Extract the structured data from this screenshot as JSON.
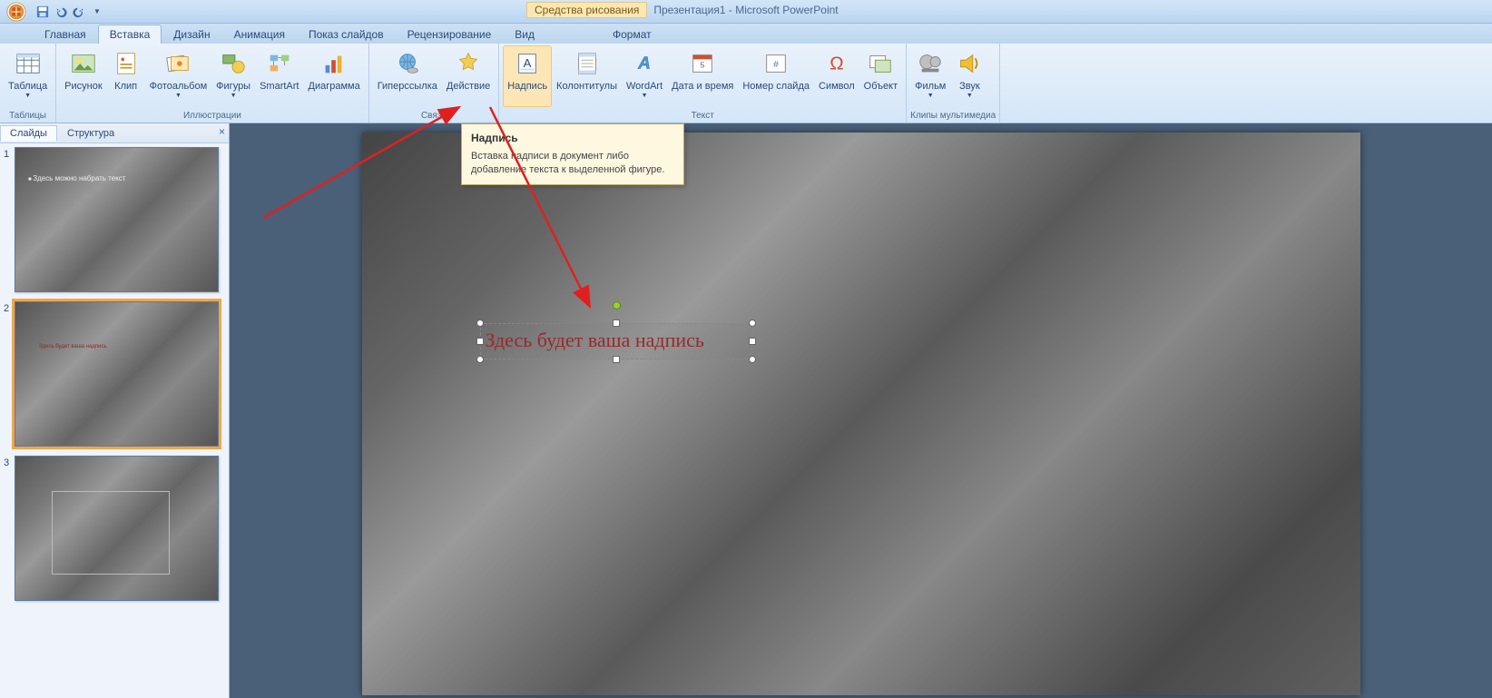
{
  "app": {
    "title_document": "Презентация1",
    "title_app": "Microsoft PowerPoint",
    "contextual_tab_group": "Средства рисования"
  },
  "qat": {
    "save": "save",
    "undo": "undo",
    "redo": "redo"
  },
  "tabs": {
    "home": "Главная",
    "insert": "Вставка",
    "design": "Дизайн",
    "animations": "Анимация",
    "slideshow": "Показ слайдов",
    "review": "Рецензирование",
    "view": "Вид",
    "format": "Формат"
  },
  "ribbon": {
    "groups": {
      "tables": "Таблицы",
      "illustrations": "Иллюстрации",
      "links": "Связи",
      "text": "Текст",
      "media": "Клипы мультимедиа"
    },
    "buttons": {
      "table": "Таблица",
      "picture": "Рисунок",
      "clip": "Клип",
      "photo_album": "Фотоальбом",
      "shapes": "Фигуры",
      "smartart": "SmartArt",
      "chart": "Диаграмма",
      "hyperlink": "Гиперссылка",
      "action": "Действие",
      "textbox": "Надпись",
      "header_footer": "Колонтитулы",
      "wordart": "WordArt",
      "datetime": "Дата и время",
      "slide_number": "Номер слайда",
      "symbol": "Символ",
      "object": "Объект",
      "movie": "Фильм",
      "sound": "Звук"
    }
  },
  "tooltip": {
    "title": "Надпись",
    "body": "Вставка надписи в документ либо добавление текста к выделенной фигуре."
  },
  "sidepanel": {
    "tab_slides": "Слайды",
    "tab_outline": "Структура",
    "slide1_text": "Здесь можно набрать текст"
  },
  "stage": {
    "textbox_text": "Здесь будет ваша надпись"
  },
  "thumb_numbers": [
    "1",
    "2",
    "3"
  ]
}
